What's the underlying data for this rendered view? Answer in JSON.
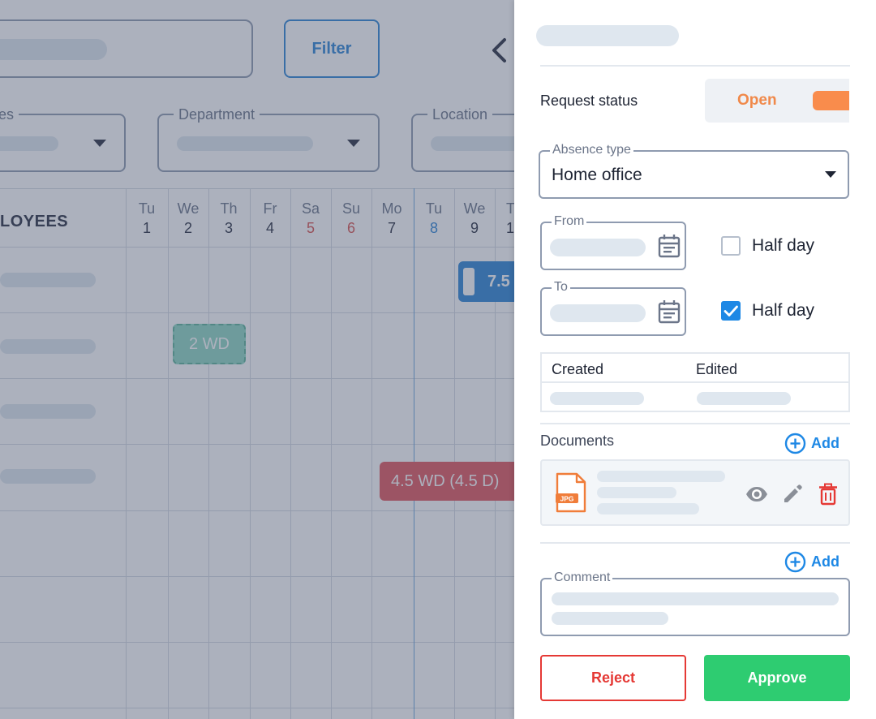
{
  "toolbar": {
    "filter_label": "Filter"
  },
  "filters": {
    "types_label": "pes",
    "department_label": "Department",
    "location_label": "Location"
  },
  "calendar": {
    "employees_header": "LOYEES",
    "days": [
      {
        "name": "Tu",
        "date": "1"
      },
      {
        "name": "We",
        "date": "2"
      },
      {
        "name": "Th",
        "date": "3"
      },
      {
        "name": "Fr",
        "date": "4"
      },
      {
        "name": "Sa",
        "date": "5"
      },
      {
        "name": "Su",
        "date": "6"
      },
      {
        "name": "Mo",
        "date": "7"
      },
      {
        "name": "Tu",
        "date": "8"
      },
      {
        "name": "We",
        "date": "9"
      },
      {
        "name": "T",
        "date": "1"
      }
    ],
    "entries": {
      "green": "2 WD",
      "blue": "7.5",
      "red": "4.5 WD (4.5 D)"
    }
  },
  "drawer": {
    "request_status_label": "Request status",
    "status_value": "Open",
    "status_color": "#f98c4c",
    "absence_type_label": "Absence type",
    "absence_type_value": "Home office",
    "from_label": "From",
    "to_label": "To",
    "half_day_label": "Half day",
    "half_day_from_checked": false,
    "half_day_to_checked": true,
    "created_label": "Created",
    "edited_label": "Edited",
    "documents_label": "Documents",
    "add_label": "Add",
    "document": {
      "file_type": "JPG"
    },
    "comment_label": "Comment",
    "reject_label": "Reject",
    "approve_label": "Approve",
    "colors": {
      "accent": "#1e88e5",
      "reject": "#e53935",
      "approve": "#2ecc71"
    }
  }
}
